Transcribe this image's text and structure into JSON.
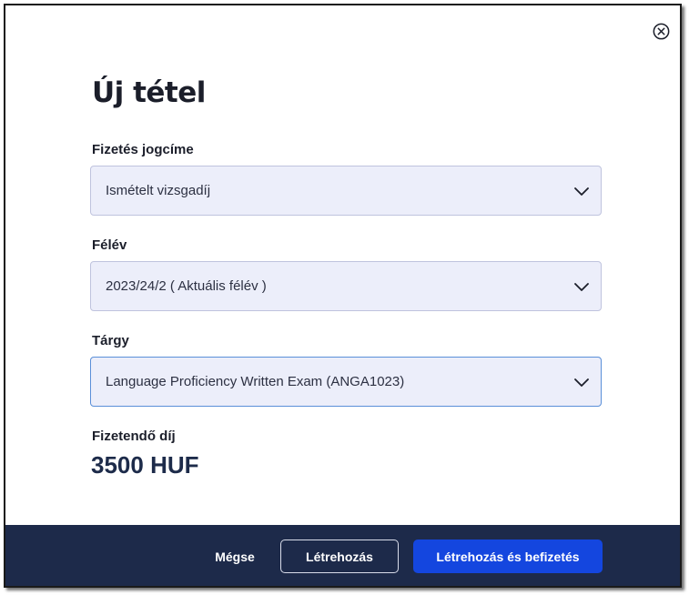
{
  "dialog": {
    "title": "Új tétel",
    "fields": [
      {
        "label": "Fizetés jogcíme",
        "value": "Ismételt vizsgadíj"
      },
      {
        "label": "Félév",
        "value": "2023/24/2 ( Aktuális félév )"
      },
      {
        "label": "Tárgy",
        "value": "Language Proficiency Written Exam (ANGA1023)"
      }
    ],
    "amount_label": "Fizetendő díj",
    "amount_value": "3500 HUF"
  },
  "footer": {
    "cancel_label": "Mégse",
    "create_label": "Létrehozás",
    "create_pay_label": "Létrehozás és befizetés"
  },
  "colors": {
    "footer_bg": "#1d2a4a",
    "primary_button": "#1446df",
    "select_bg": "#eceefa"
  },
  "icons": {
    "close": "close-circle-icon",
    "dropdown": "chevron-down-icon"
  }
}
